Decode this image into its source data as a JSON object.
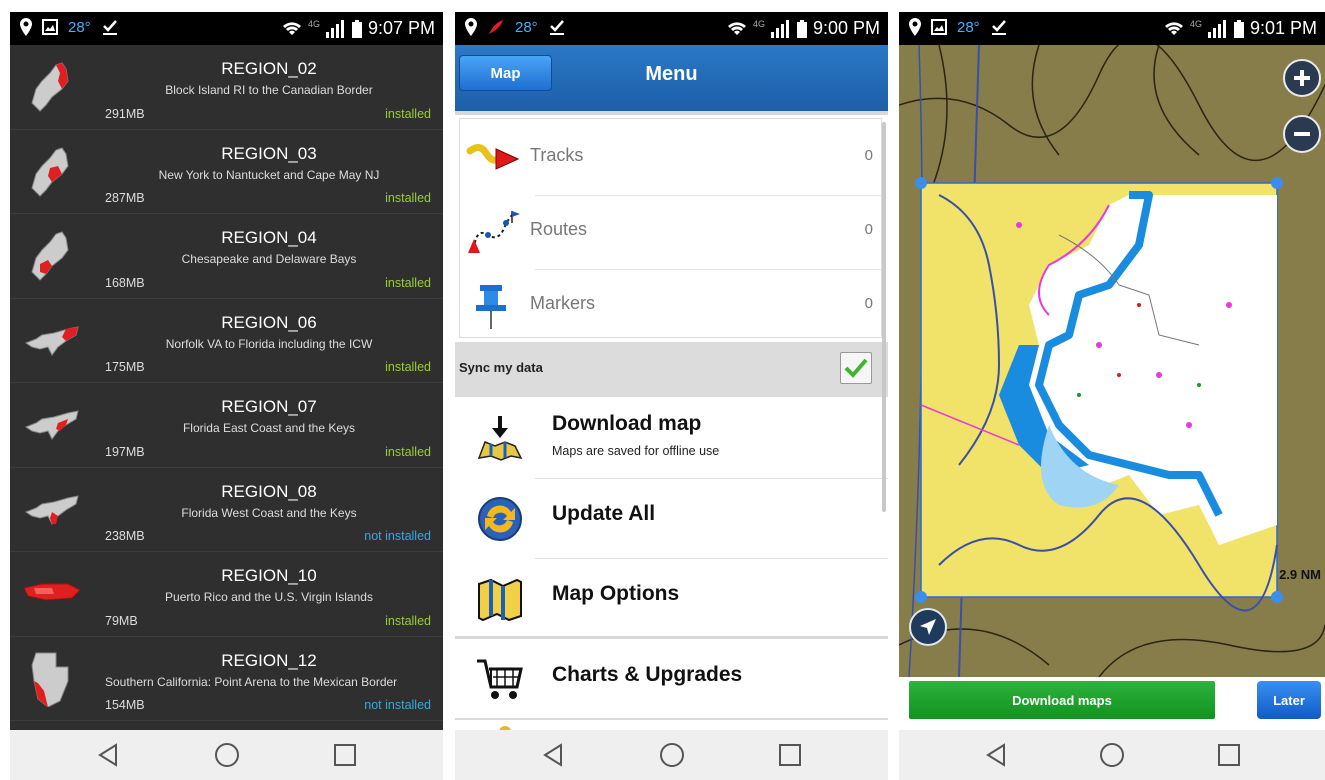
{
  "screen1": {
    "status": {
      "temp": "28°",
      "time": "9:07 PM",
      "net": "4G"
    },
    "regions": [
      {
        "name": "REGION_02",
        "desc": "Block Island RI to the Canadian Border",
        "size": "291MB",
        "status": "installed"
      },
      {
        "name": "REGION_03",
        "desc": "New York to Nantucket and Cape May NJ",
        "size": "287MB",
        "status": "installed"
      },
      {
        "name": "REGION_04",
        "desc": "Chesapeake and Delaware Bays",
        "size": "168MB",
        "status": "installed"
      },
      {
        "name": "REGION_06",
        "desc": "Norfolk VA to Florida including the ICW",
        "size": "175MB",
        "status": "installed"
      },
      {
        "name": "REGION_07",
        "desc": "Florida East Coast and the Keys",
        "size": "197MB",
        "status": "installed"
      },
      {
        "name": "REGION_08",
        "desc": "Florida West Coast and the Keys",
        "size": "238MB",
        "status": "not installed"
      },
      {
        "name": "REGION_10",
        "desc": "Puerto Rico and the U.S. Virgin Islands",
        "size": "79MB",
        "status": "installed"
      },
      {
        "name": "REGION_12",
        "desc": "Southern California: Point Arena to the Mexican Border",
        "size": "154MB",
        "status": "not installed"
      }
    ]
  },
  "screen2": {
    "status": {
      "temp": "28°",
      "time": "9:00 PM",
      "net": "4G"
    },
    "header": {
      "map_button": "Map",
      "title": "Menu"
    },
    "tracks": [
      {
        "label": "Tracks",
        "count": "0"
      },
      {
        "label": "Routes",
        "count": "0"
      },
      {
        "label": "Markers",
        "count": "0"
      }
    ],
    "sync": {
      "label": "Sync my data",
      "checked": true
    },
    "menu": [
      {
        "title": "Download map",
        "subtitle": "Maps are saved for offline use"
      },
      {
        "title": "Update All",
        "subtitle": ""
      },
      {
        "title": "Map Options",
        "subtitle": ""
      },
      {
        "title": "Charts & Upgrades",
        "subtitle": ""
      }
    ]
  },
  "screen3": {
    "status": {
      "temp": "28°",
      "time": "9:01 PM",
      "net": "4G"
    },
    "scale": "2.9 NM",
    "download_button": "Download maps",
    "later_button": "Later"
  },
  "colors": {
    "installed": "#9acd32",
    "not_installed": "#33aadd",
    "header_blue": "#1c5fa8",
    "download_green": "#1aa32b"
  }
}
